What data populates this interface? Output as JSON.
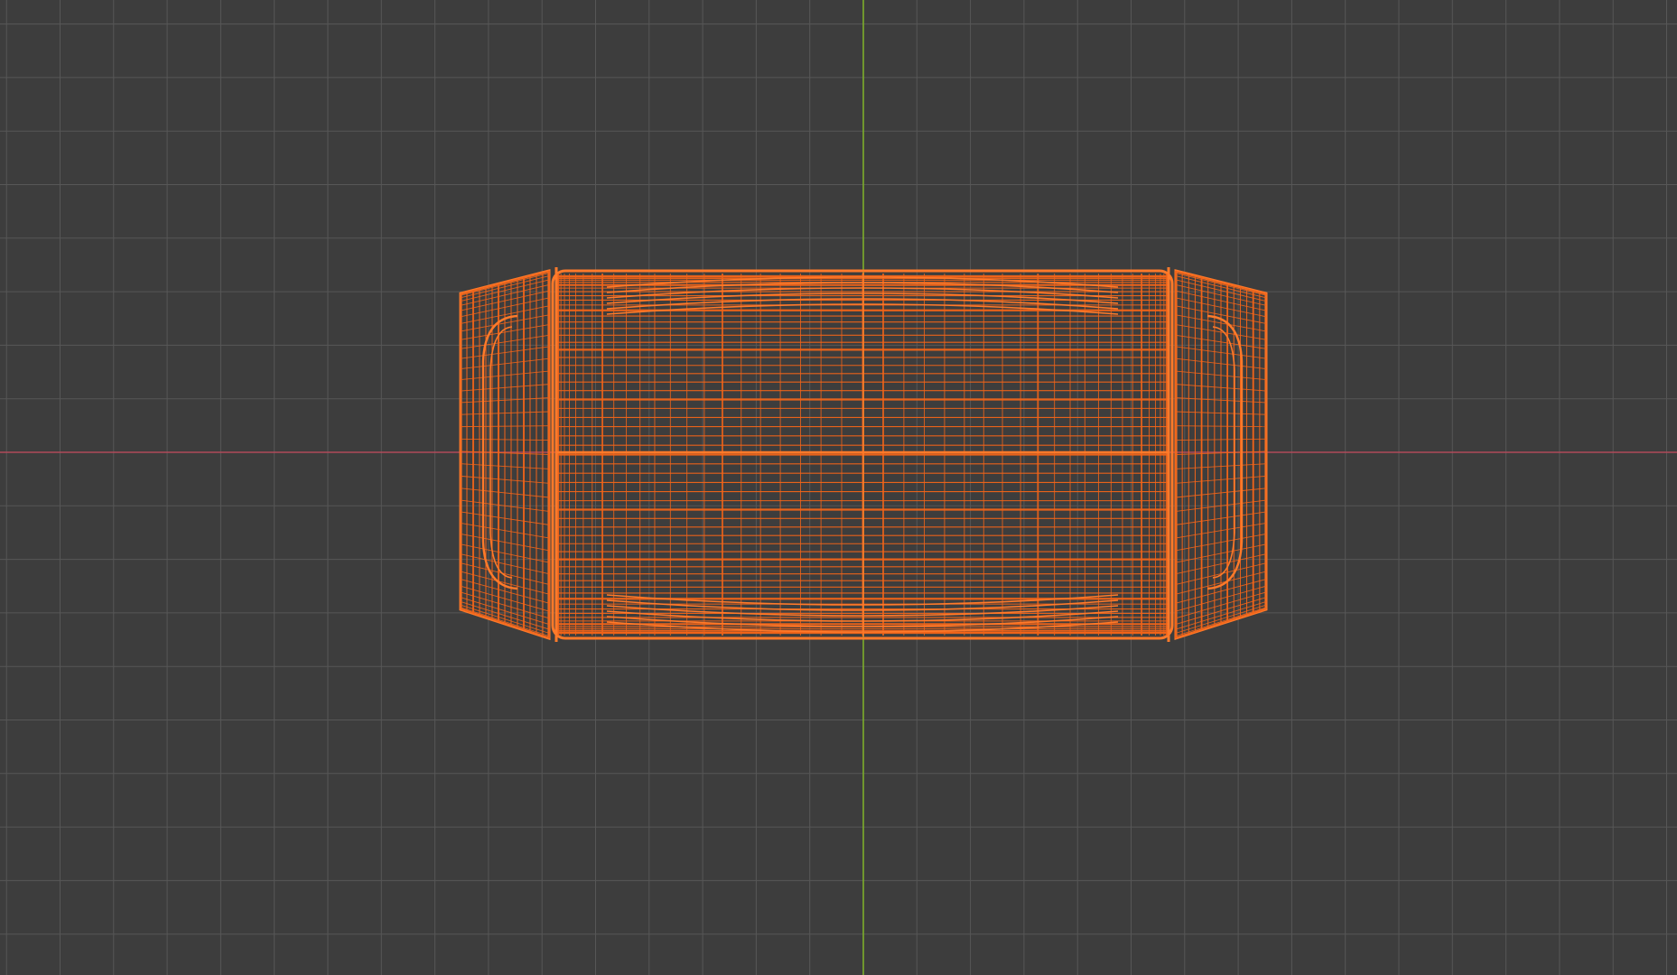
{
  "viewport": {
    "view": "top-orthographic",
    "display_mode": "wireframe",
    "background_color": "#3d3d3d",
    "grid_color": "#575757",
    "x_axis_color": "#b04a5a",
    "y_axis_color": "#7cae2a",
    "selection_color": "#f26419",
    "selection_highlight_color": "#ff7a2a"
  },
  "scene": {
    "selected_object": {
      "shape": "rounded-box-with-beveled-ends",
      "selected": true
    }
  }
}
